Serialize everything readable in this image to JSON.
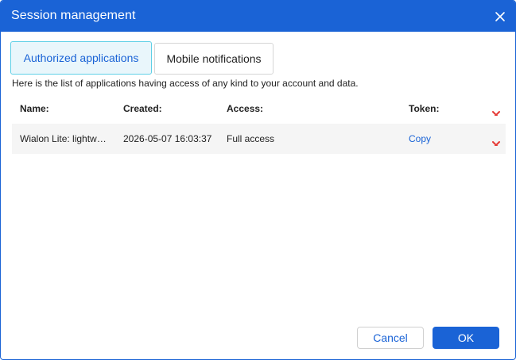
{
  "dialog": {
    "title": "Session management"
  },
  "tabs": [
    {
      "label": "Authorized applications",
      "active": true
    },
    {
      "label": "Mobile notifications",
      "active": false
    }
  ],
  "description": "Here is the list of applications having access of any kind to your account and data.",
  "table": {
    "headers": {
      "name": "Name:",
      "created": "Created:",
      "access": "Access:",
      "token": "Token:"
    },
    "rows": [
      {
        "name": "Wialon Lite: lightw…",
        "created": "2026-05-07 16:03:37",
        "access": "Full access",
        "token": "Copy"
      }
    ]
  },
  "footer": {
    "cancel_label": "Cancel",
    "ok_label": "OK"
  },
  "icons": {
    "close": "close-icon",
    "delete": "delete-x-icon"
  },
  "colors": {
    "accent": "#1a63d6",
    "delete": "#e53935",
    "active_tab_border": "#5fd0e6"
  }
}
